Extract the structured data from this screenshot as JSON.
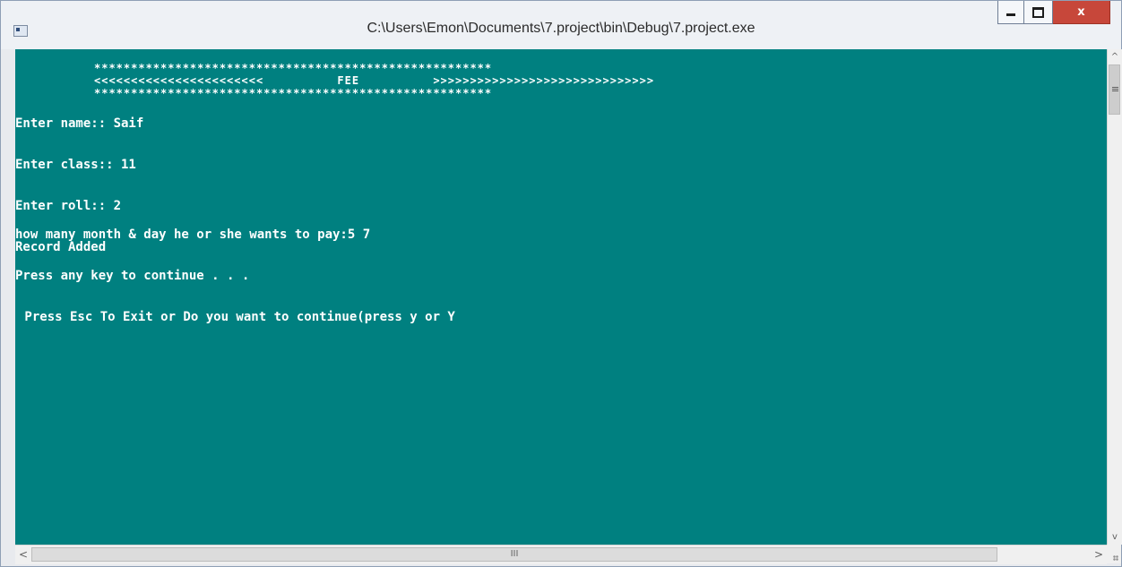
{
  "window": {
    "title": "C:\\Users\\Emon\\Documents\\7.project\\bin\\Debug\\7.project.exe",
    "icon": "console-app-icon",
    "controls": {
      "minimize_icon": "minimize-icon",
      "maximize_icon": "maximize-icon",
      "close_label": "x"
    }
  },
  "console": {
    "background": "#008080",
    "text_color": "#ffffff",
    "banner_top": "******************************************************",
    "banner_middle": "<<<<<<<<<<<<<<<<<<<<<<<          FEE          >>>>>>>>>>>>>>>>>>>>>>>>>>>>>>",
    "banner_bottom": "******************************************************",
    "lines": [
      "Enter name:: Saif",
      "Enter class:: 11",
      "Enter roll:: 2",
      "how many month & day he or she wants to pay:5 7",
      "Record Added",
      "Press any key to continue . . .",
      " Press Esc To Exit or Do you want to continue(press y or Y"
    ]
  },
  "scrollbars": {
    "up": "^",
    "down": "v",
    "left": "<",
    "right": ">",
    "thumb_grip": "III"
  }
}
